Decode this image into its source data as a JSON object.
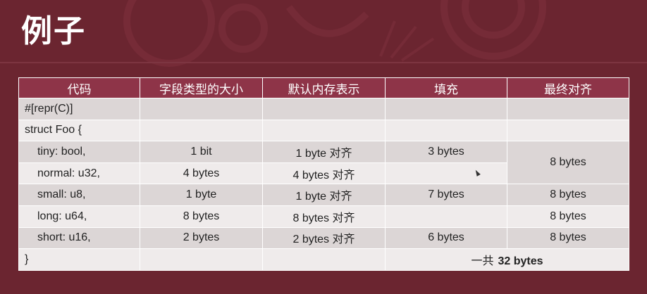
{
  "slide": {
    "title": "例子"
  },
  "colors": {
    "background": "#6b2530",
    "header": "#8e3448",
    "row_dark": "#dcd6d6",
    "row_light": "#efebeb"
  },
  "table": {
    "headers": [
      "代码",
      "字段类型的大小",
      "默认内存表示",
      "填充",
      "最终对齐"
    ],
    "rows": [
      {
        "code": "#[repr(C)]",
        "size": "",
        "repr": "",
        "padding": "",
        "align": ""
      },
      {
        "code": "struct Foo {",
        "size": "",
        "repr": "",
        "padding": "",
        "align": ""
      },
      {
        "code": "tiny: bool,",
        "size": "1 bit",
        "repr": "1 byte 对齐",
        "padding": "3 bytes",
        "align": "8 bytes"
      },
      {
        "code": "normal: u32,",
        "size": "4 bytes",
        "repr": "4 bytes 对齐",
        "padding": ""
      },
      {
        "code": "small: u8,",
        "size": "1 byte",
        "repr": "1 byte 对齐",
        "padding": "7 bytes",
        "align": "8 bytes"
      },
      {
        "code": "long: u64,",
        "size": "8 bytes",
        "repr": "8 bytes 对齐",
        "padding": "",
        "align": "8 bytes"
      },
      {
        "code": "short: u16,",
        "size": "2 bytes",
        "repr": "2 bytes 对齐",
        "padding": "6 bytes",
        "align": "8 bytes"
      },
      {
        "code": "}",
        "size": "",
        "repr": ""
      }
    ],
    "total": {
      "prefix": "一共",
      "value": "32 bytes"
    }
  }
}
